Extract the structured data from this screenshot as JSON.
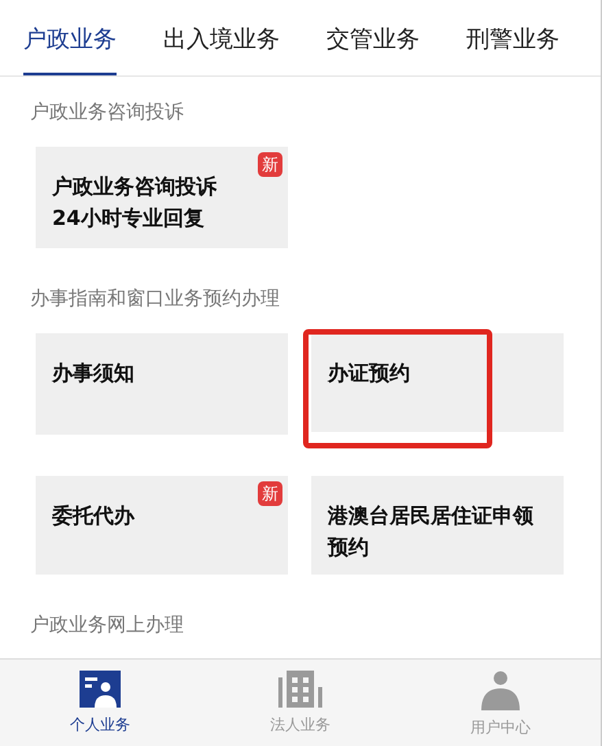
{
  "tabs": [
    {
      "label": "户政业务",
      "selected": true
    },
    {
      "label": "出入境业务",
      "selected": false
    },
    {
      "label": "交管业务",
      "selected": false
    },
    {
      "label": "刑警业务",
      "selected": false
    }
  ],
  "sections": [
    {
      "title": "户政业务咨询投诉",
      "cards": [
        {
          "label": "户政业务咨询投诉\n24小时专业回复",
          "badge": "新",
          "highlighted": false
        }
      ]
    },
    {
      "title": "办事指南和窗口业务预约办理",
      "cards": [
        {
          "label": "办事须知",
          "highlighted": false
        },
        {
          "label": "办证预约",
          "highlighted": true
        },
        {
          "label": "委托代办",
          "badge": "新",
          "highlighted": false
        },
        {
          "label": "港澳台居民居住证申领预约",
          "highlighted": false
        }
      ]
    },
    {
      "title": "户政业务网上办理"
    }
  ],
  "bottom_nav": [
    {
      "label": "个人业务",
      "kind": "person-card",
      "selected": true
    },
    {
      "label": "法人业务",
      "kind": "building",
      "selected": false
    },
    {
      "label": "用户中心",
      "kind": "user",
      "selected": false
    }
  ]
}
